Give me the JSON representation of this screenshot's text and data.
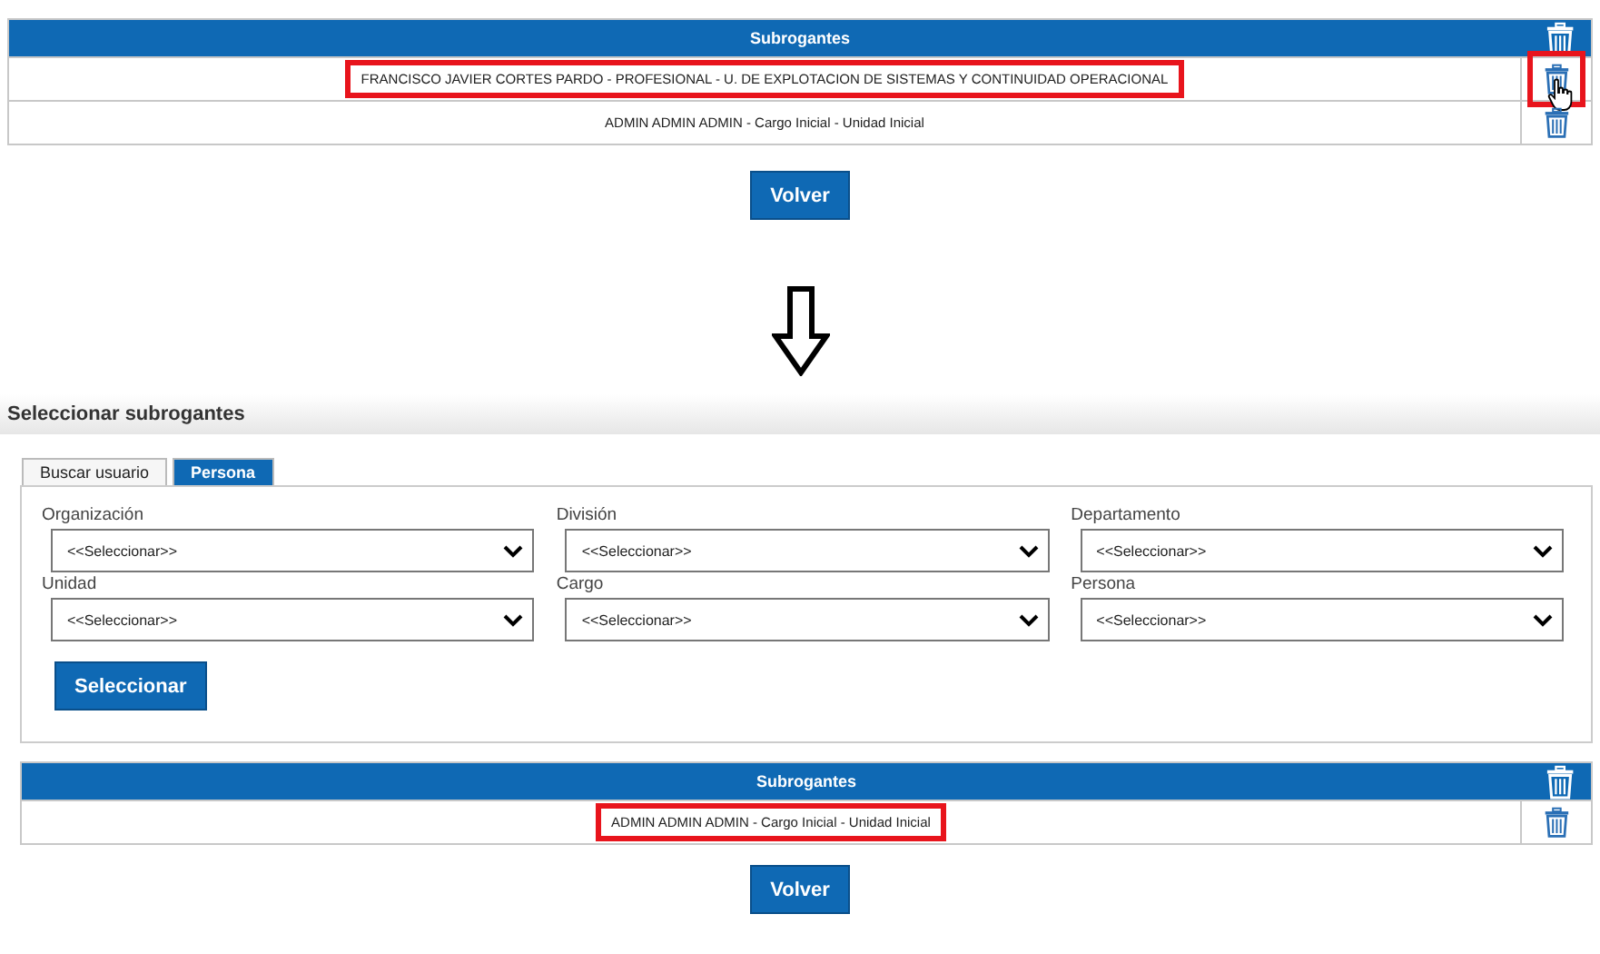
{
  "top_table": {
    "title": "Subrogantes",
    "rows": [
      {
        "text": "FRANCISCO JAVIER CORTES PARDO - PROFESIONAL - U. DE EXPLOTACION DE SISTEMAS Y CONTINUIDAD OPERACIONAL",
        "highlighted": true,
        "delete_highlighted": true,
        "cursor": true
      },
      {
        "text": "ADMIN ADMIN ADMIN - Cargo Inicial - Unidad Inicial",
        "highlighted": false,
        "delete_highlighted": false,
        "cursor": false
      }
    ]
  },
  "top_button": "Volver",
  "section_title": "Seleccionar subrogantes",
  "tabs": [
    {
      "label": "Buscar usuario",
      "selected": false
    },
    {
      "label": "Persona",
      "selected": true
    }
  ],
  "fields": [
    {
      "label": "Organización",
      "value": "<<Seleccionar>>"
    },
    {
      "label": "División",
      "value": "<<Seleccionar>>"
    },
    {
      "label": "Departamento",
      "value": "<<Seleccionar>>"
    },
    {
      "label": "Unidad",
      "value": "<<Seleccionar>>"
    },
    {
      "label": "Cargo",
      "value": "<<Seleccionar>>"
    },
    {
      "label": "Persona",
      "value": "<<Seleccionar>>"
    }
  ],
  "select_button": "Seleccionar",
  "bottom_table": {
    "title": "Subrogantes",
    "rows": [
      {
        "text": "ADMIN ADMIN ADMIN - Cargo Inicial - Unidad Inicial",
        "highlighted": true,
        "delete_highlighted": false,
        "cursor": false
      }
    ]
  },
  "bottom_button": "Volver"
}
